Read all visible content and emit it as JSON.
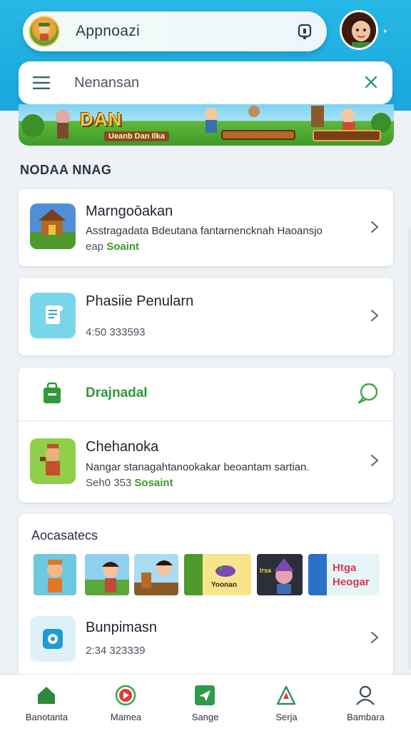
{
  "header": {
    "app_title": "Appnoazi",
    "colors": {
      "accent": "#1aa7dc",
      "green": "#3c9a28"
    }
  },
  "search": {
    "value": "Nenansan"
  },
  "banner": {
    "title": "DAN",
    "subtitle": "Ueanb Dan Ilka"
  },
  "section": {
    "title": "NODAA NNAG"
  },
  "cards": [
    {
      "title": "Marngoōakan",
      "subtitle": "Asstragadata Bdeutana fantarnencknah Haoansjo",
      "meta_prefix": "eap",
      "meta_highlight": "Soaint"
    },
    {
      "title": "Phasiie Penularn",
      "meta": "4:50 333593"
    }
  ],
  "group_card": {
    "header_title": "Drajnadal",
    "item": {
      "title": "Chehanoka",
      "subtitle": "Nangar stanagahtanookakar beoantam sartian.",
      "meta_prefix": "Seh0 353",
      "meta_highlight": "Sosaint"
    }
  },
  "associates": {
    "title": "Aocasatecs",
    "thumbs": [
      "",
      "",
      "",
      "Yoonan",
      "Irsa",
      "Htga Heogar"
    ]
  },
  "last_card": {
    "title": "Bunpimasn",
    "meta": "2:34 323339"
  },
  "bottom_nav": [
    {
      "label": "Banotanta",
      "icon": "home-icon",
      "active": true
    },
    {
      "label": "Mamea",
      "icon": "record-icon"
    },
    {
      "label": "Sange",
      "icon": "plane-icon"
    },
    {
      "label": "Serja",
      "icon": "shape-icon"
    },
    {
      "label": "Bambara",
      "icon": "person-icon"
    }
  ]
}
